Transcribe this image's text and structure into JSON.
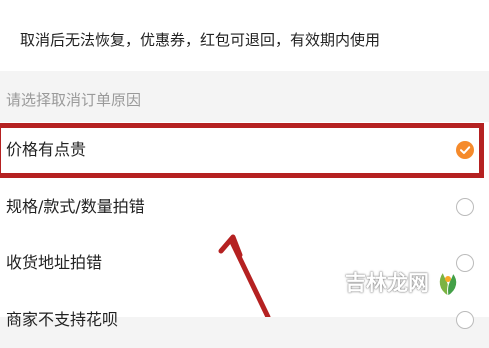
{
  "notice": {
    "text": "取消后无法恢复，优惠券，红包可退回，有效期内使用"
  },
  "reason_section": {
    "label": "请选择取消订单原因"
  },
  "reasons": [
    {
      "label": "价格有点贵",
      "selected": true
    },
    {
      "label": "规格/款式/数量拍错",
      "selected": false
    },
    {
      "label": "收货地址拍错",
      "selected": false
    },
    {
      "label": "商家不支持花呗",
      "selected": false
    }
  ],
  "colors": {
    "selected_accent": "#f58a2b",
    "highlight_annotation": "#b52121",
    "arrow_annotation": "#b52121"
  },
  "watermark": {
    "text": "吉林龙网",
    "icon": "leaf-logo-icon"
  }
}
